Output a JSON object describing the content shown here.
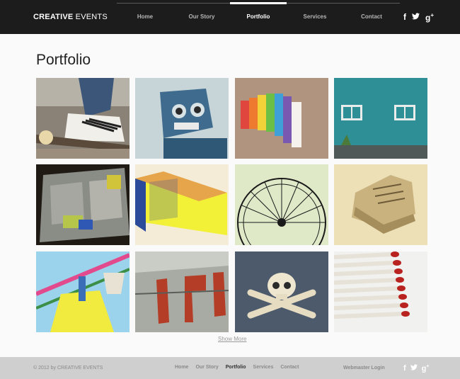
{
  "header": {
    "logo_bold": "CREATIVE",
    "logo_light": " EVENTS",
    "nav": [
      {
        "label": "Home",
        "active": false
      },
      {
        "label": "Our Story",
        "active": false
      },
      {
        "label": "Portfolio",
        "active": true
      },
      {
        "label": "Services",
        "active": false
      },
      {
        "label": "Contact",
        "active": false
      }
    ],
    "social": {
      "facebook": "f",
      "twitter": "t",
      "googleplus": "g+"
    }
  },
  "main": {
    "title": "Portfolio",
    "show_more": "Show More",
    "tiles": [
      "skateboard-sneakers",
      "blue-robot-toy",
      "rainbow-crayons",
      "teal-wall-windows",
      "kitchen-sink-dishes",
      "matchbox-yellow",
      "ferris-wheel",
      "worn-sneakers",
      "carnival-ride",
      "old-airplane",
      "skull-crossbones",
      "matchsticks"
    ]
  },
  "footer": {
    "copyright": "© 2012 by CREATIVE EVENTS",
    "nav": [
      {
        "label": "Home",
        "active": false
      },
      {
        "label": "Our Story",
        "active": false
      },
      {
        "label": "Portfolio",
        "active": true
      },
      {
        "label": "Services",
        "active": false
      },
      {
        "label": "Contact",
        "active": false
      }
    ],
    "webmaster": "Webmaster Login",
    "social": {
      "facebook": "f",
      "twitter": "t",
      "googleplus": "g+"
    }
  }
}
